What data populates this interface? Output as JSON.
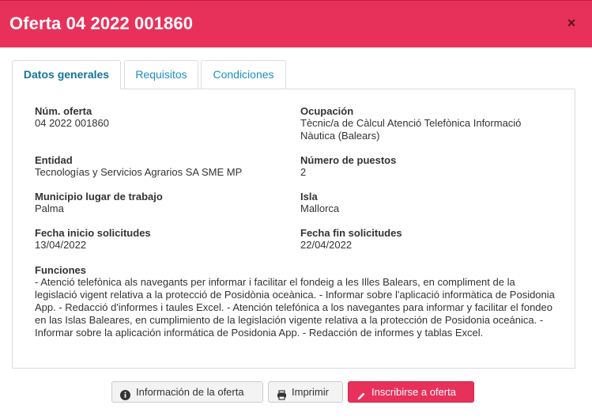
{
  "header": {
    "title": "Oferta 04 2022 001860",
    "close_label": "×"
  },
  "tabs": [
    {
      "label": "Datos generales",
      "active": true
    },
    {
      "label": "Requisitos",
      "active": false
    },
    {
      "label": "Condiciones",
      "active": false
    }
  ],
  "fields": {
    "num_oferta": {
      "label": "Núm. oferta",
      "value": "04 2022 001860"
    },
    "ocupacion": {
      "label": "Ocupación",
      "value": "Tècnic/a de Càlcul Atenció Telefònica Informació Nàutica (Balears)"
    },
    "entidad": {
      "label": "Entidad",
      "value": "Tecnologías y Servicios Agrarios SA SME MP"
    },
    "numero_puestos": {
      "label": "Número de puestos",
      "value": "2"
    },
    "municipio": {
      "label": "Municipio lugar de trabajo",
      "value": "Palma"
    },
    "isla": {
      "label": "Isla",
      "value": "Mallorca"
    },
    "fecha_inicio": {
      "label": "Fecha inicio solicitudes",
      "value": "13/04/2022"
    },
    "fecha_fin": {
      "label": "Fecha fin solicitudes",
      "value": "22/04/2022"
    },
    "funciones": {
      "label": "Funciones",
      "value": "- Atenció telefònica als navegants per informar i facilitar el fondeig a les Illes Balears, en compliment de la legislació vigent relativa a la protecció de Posidònia oceànica. - Informar sobre l'aplicació informàtica de Posidonia App. - Redacció d'informes i taules Excel. - Atención telefónica a los navegantes para informar y facilitar el fondeo en las Islas Baleares, en cumplimiento de la legislación vigente relativa a la protección de Posidonia oceánica. - Informar sobre la aplicación informática de Posidonia App. - Redacción de informes y tablas Excel."
    }
  },
  "footer": {
    "info_button": "Información de la oferta",
    "print_button": "Imprimir",
    "apply_button": "Inscribirse a oferta"
  },
  "colors": {
    "accent": "#e8315a",
    "tab_text": "#1a8fc6"
  },
  "icons": {
    "info": "info-circle-icon",
    "print": "printer-icon",
    "apply": "pencil-icon"
  }
}
